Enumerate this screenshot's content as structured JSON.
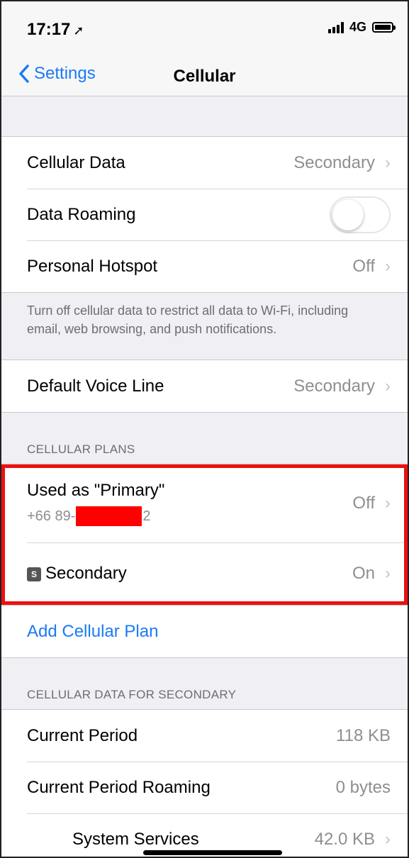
{
  "status_bar": {
    "time": "17:17",
    "location_arrow": "location-arrow-icon",
    "network": "4G"
  },
  "nav": {
    "back_label": "Settings",
    "title": "Cellular"
  },
  "group1": {
    "cellular_data_label": "Cellular Data",
    "cellular_data_value": "Secondary",
    "data_roaming_label": "Data Roaming",
    "data_roaming_on": false,
    "hotspot_label": "Personal Hotspot",
    "hotspot_value": "Off"
  },
  "footer_note": "Turn off cellular data to restrict all data to Wi-Fi, including email, web browsing, and push notifications.",
  "voice": {
    "label": "Default Voice Line",
    "value": "Secondary"
  },
  "plans": {
    "header": "CELLULAR PLANS",
    "primary_title": "Used as \"Primary\"",
    "primary_number_prefix": "+66 89-",
    "primary_number_suffix": "2",
    "primary_value": "Off",
    "secondary_badge": "S",
    "secondary_label": "Secondary",
    "secondary_value": "On",
    "add_label": "Add Cellular Plan"
  },
  "usage": {
    "header": "CELLULAR DATA FOR SECONDARY",
    "current_label": "Current Period",
    "current_value": "118 KB",
    "roaming_label": "Current Period Roaming",
    "roaming_value": "0 bytes",
    "system_label": "System Services",
    "system_value": "42.0 KB"
  },
  "colors": {
    "accent": "#1a7af5",
    "highlight": "#ee1010",
    "redaction": "#ff0000"
  },
  "chevron": "›"
}
